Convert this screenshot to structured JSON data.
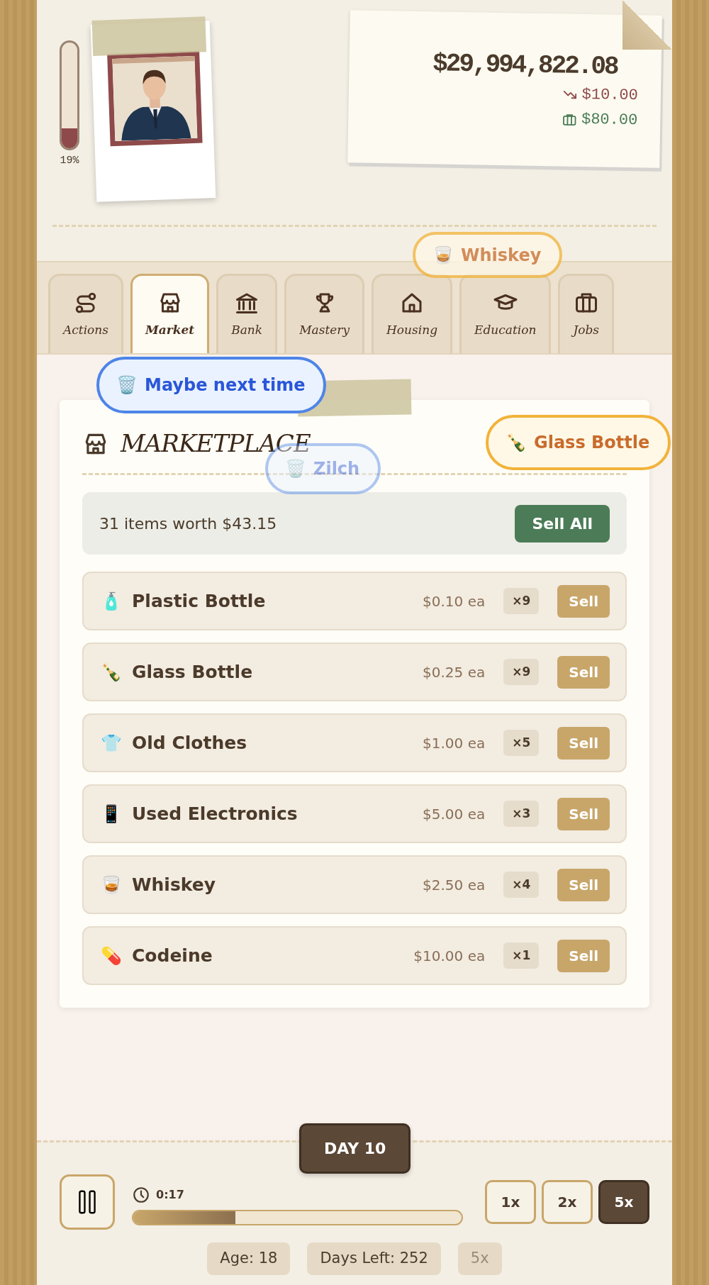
{
  "vitality": {
    "level": 0.19,
    "reading": "19%"
  },
  "money": {
    "balance": "$29,994,822.08",
    "flows": [
      {
        "kind": "expense",
        "amount": "$10.00"
      },
      {
        "kind": "income",
        "amount": "$80.00"
      }
    ]
  },
  "tabs": [
    {
      "label": "Actions",
      "selected": false
    },
    {
      "label": "Market",
      "selected": true
    },
    {
      "label": "Bank",
      "selected": false
    },
    {
      "label": "Mastery",
      "selected": false
    },
    {
      "label": "Housing",
      "selected": false
    },
    {
      "label": "Education",
      "selected": false
    },
    {
      "label": "Jobs",
      "selected": false
    }
  ],
  "toasts": [
    {
      "kind": "item",
      "icon": "🥃",
      "text": "Whiskey",
      "faded": true
    },
    {
      "kind": "fail",
      "icon": "🗑️",
      "text": "Maybe next time",
      "faded": false
    },
    {
      "kind": "item",
      "icon": "🍾",
      "text": "Glass Bottle",
      "faded": false
    },
    {
      "kind": "fail",
      "icon": "🗑️",
      "text": "Zilch",
      "faded": true
    }
  ],
  "market": {
    "title": "MARKETPLACE",
    "summary": "31 items worth $43.15",
    "sell_all": "Sell All",
    "items": [
      {
        "icon": "🧴",
        "name": "Plastic Bottle",
        "price": "$0.10 ea",
        "quantity": "×9",
        "action": "Sell"
      },
      {
        "icon": "🍾",
        "name": "Glass Bottle",
        "price": "$0.25 ea",
        "quantity": "×9",
        "action": "Sell"
      },
      {
        "icon": "👕",
        "name": "Old Clothes",
        "price": "$1.00 ea",
        "quantity": "×5",
        "action": "Sell"
      },
      {
        "icon": "📱",
        "name": "Used Electronics",
        "price": "$5.00 ea",
        "quantity": "×3",
        "action": "Sell"
      },
      {
        "icon": "🥃",
        "name": "Whiskey",
        "price": "$2.50 ea",
        "quantity": "×4",
        "action": "Sell"
      },
      {
        "icon": "💊",
        "name": "Codeine",
        "price": "$10.00 ea",
        "quantity": "×1",
        "action": "Sell"
      }
    ]
  },
  "footer": {
    "day": "DAY 10",
    "time": "0:17",
    "level": 0.31,
    "speeds": [
      {
        "label": "1x",
        "selected": false
      },
      {
        "label": "2x",
        "selected": false
      },
      {
        "label": "5x",
        "selected": true
      }
    ],
    "chips": [
      {
        "text": "Age: 18",
        "dim": false
      },
      {
        "text": "Days Left: 252",
        "dim": false
      },
      {
        "text": "5x",
        "dim": true
      }
    ]
  }
}
